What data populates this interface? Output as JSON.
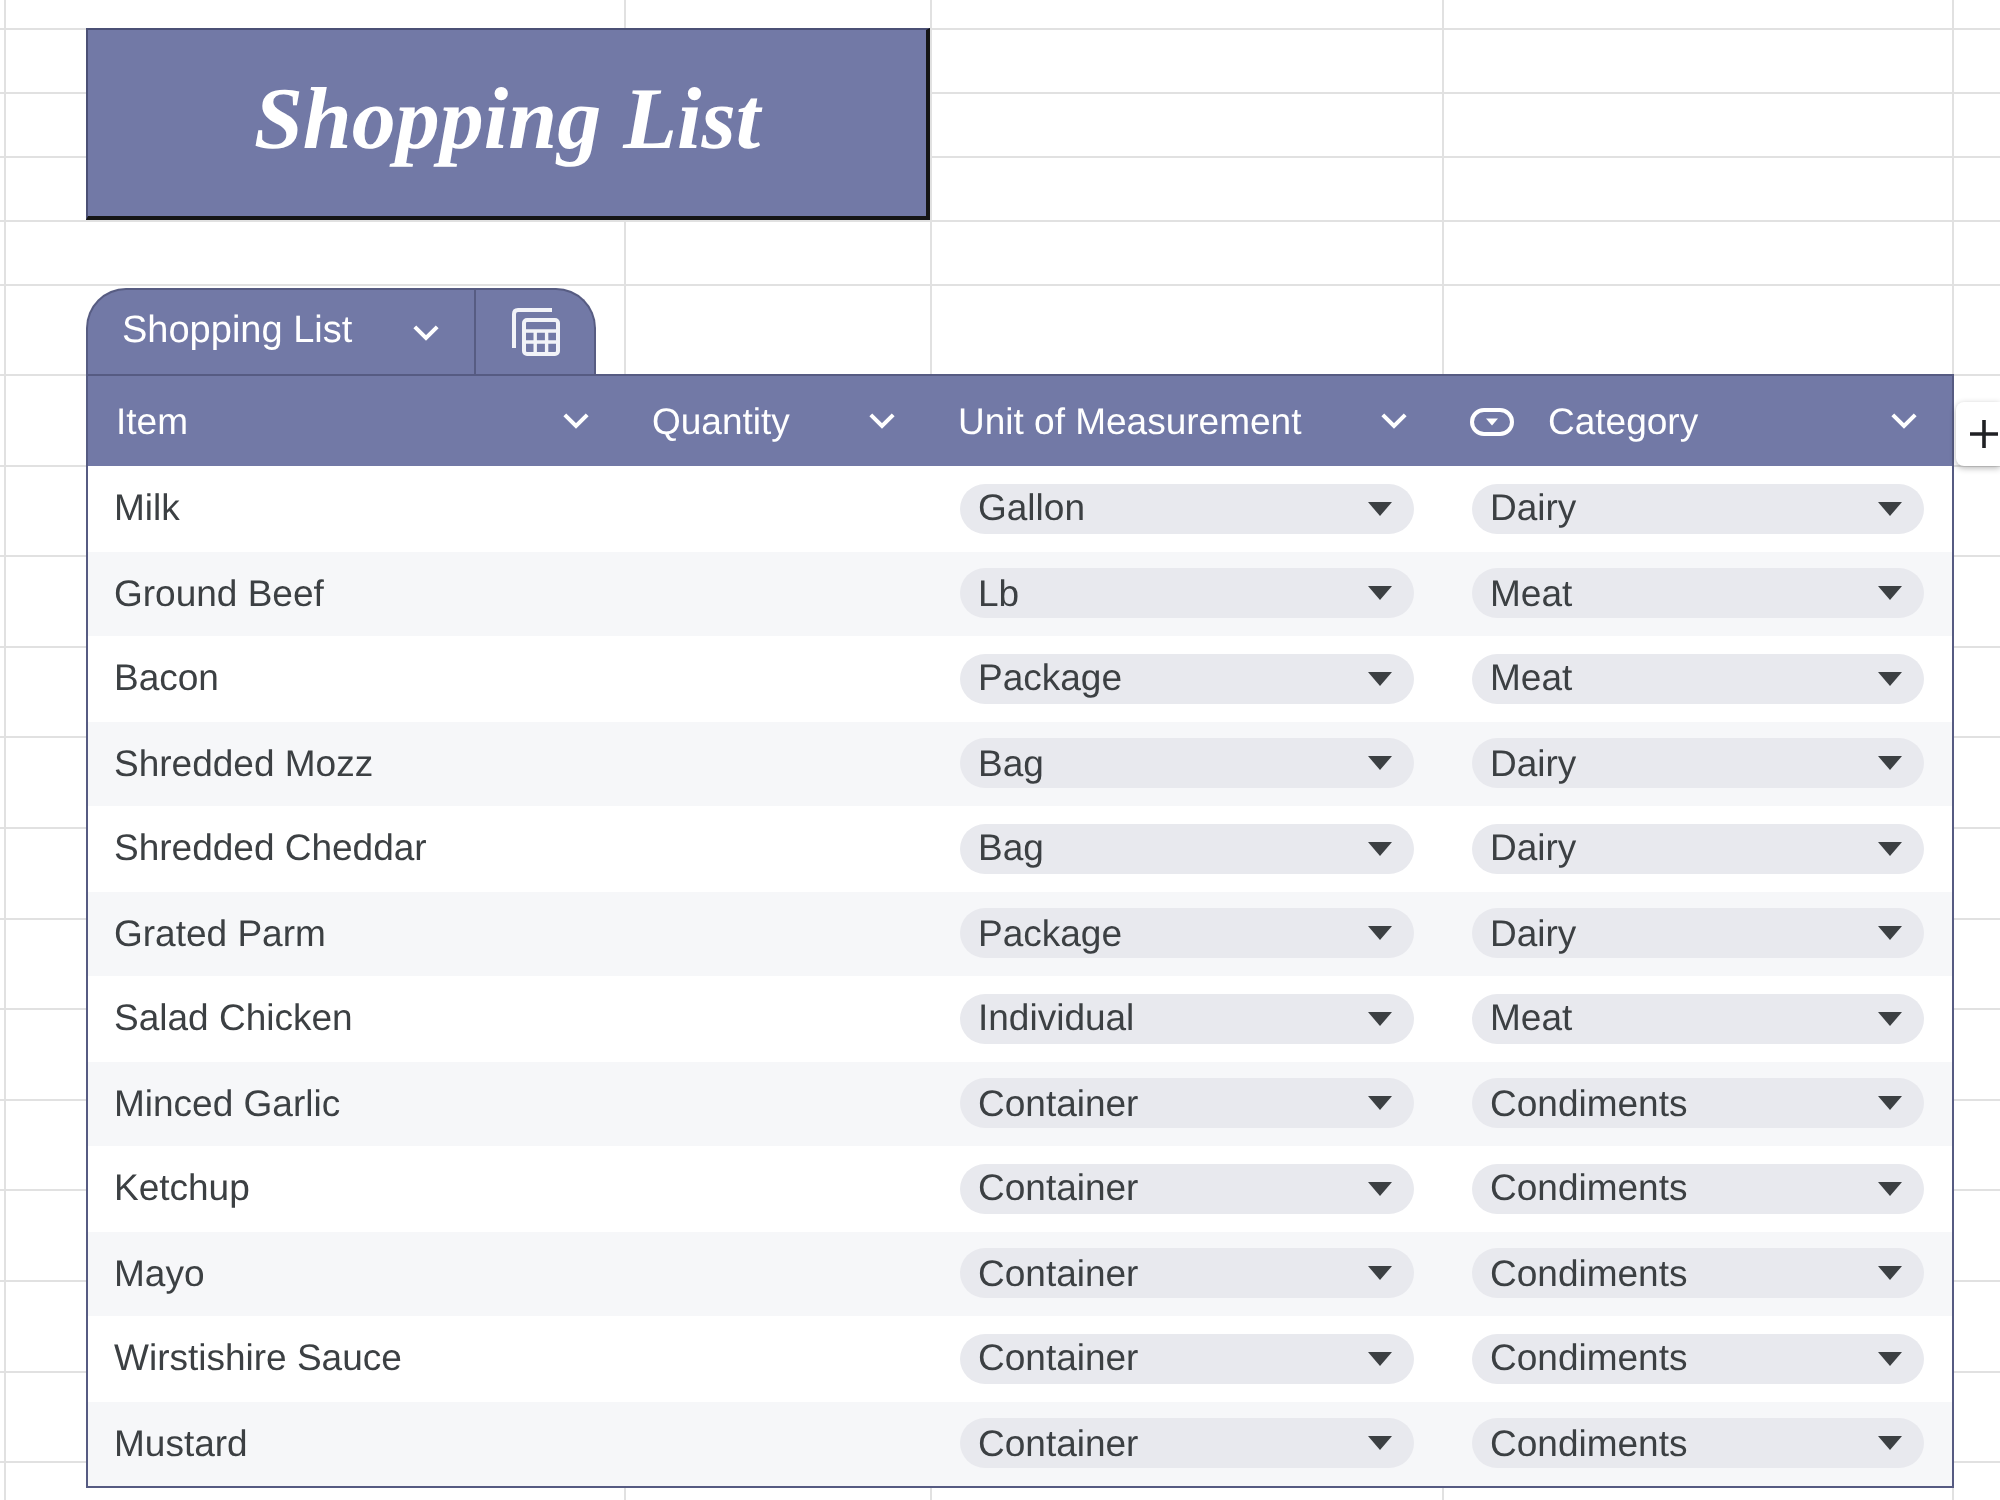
{
  "title": "Shopping List",
  "table": {
    "tab": {
      "label": "Shopping List"
    },
    "columns": [
      {
        "label": "Item",
        "kind": "text"
      },
      {
        "label": "Quantity",
        "kind": "text"
      },
      {
        "label": "Unit of Measurement",
        "kind": "text"
      },
      {
        "label": "Category",
        "kind": "dropdown"
      }
    ],
    "rows": [
      {
        "item": "Milk",
        "unit": "Gallon",
        "category": "Dairy"
      },
      {
        "item": "Ground Beef",
        "unit": "Lb",
        "category": "Meat"
      },
      {
        "item": "Bacon",
        "unit": "Package",
        "category": "Meat"
      },
      {
        "item": "Shredded Mozz",
        "unit": "Bag",
        "category": "Dairy"
      },
      {
        "item": "Shredded Cheddar",
        "unit": "Bag",
        "category": "Dairy"
      },
      {
        "item": "Grated Parm",
        "unit": "Package",
        "category": "Dairy"
      },
      {
        "item": "Salad Chicken",
        "unit": "Individual",
        "category": "Meat"
      },
      {
        "item": "Minced Garlic",
        "unit": "Container",
        "category": "Condiments"
      },
      {
        "item": "Ketchup",
        "unit": "Container",
        "category": "Condiments"
      },
      {
        "item": "Mayo",
        "unit": "Container",
        "category": "Condiments"
      },
      {
        "item": "Wirstishire Sauce",
        "unit": "Container",
        "category": "Condiments"
      },
      {
        "item": "Mustard",
        "unit": "Container",
        "category": "Condiments"
      }
    ]
  }
}
